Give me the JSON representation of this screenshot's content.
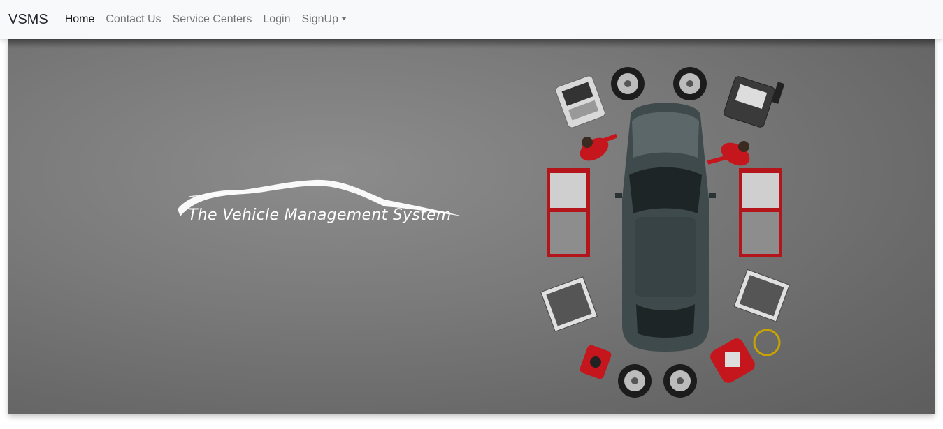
{
  "navbar": {
    "brand": "VSMS",
    "links": [
      {
        "label": "Home",
        "active": true
      },
      {
        "label": "Contact Us",
        "active": false
      },
      {
        "label": "Service Centers",
        "active": false
      },
      {
        "label": "Login",
        "active": false
      },
      {
        "label": "SignUp",
        "active": false,
        "dropdown": true
      }
    ]
  },
  "hero": {
    "tagline": "The Vehicle Management System",
    "logo_icon": "car-silhouette-logo",
    "illustration": "car-service-workshop-top-view"
  },
  "colors": {
    "navbar_bg": "#f8f9fa",
    "hero_bg": "#7a7a7a",
    "car_body": "#3f4a4c",
    "mechanic_red": "#c4161c"
  }
}
